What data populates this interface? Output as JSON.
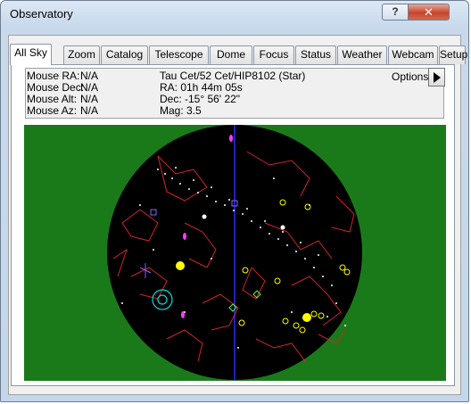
{
  "window": {
    "title": "Observatory",
    "help_label": "?",
    "close_label": "✕"
  },
  "tabs": [
    {
      "label": "All Sky",
      "active": true
    },
    {
      "label": "Zoom"
    },
    {
      "label": "Catalog"
    },
    {
      "label": "Telescope"
    },
    {
      "label": "Dome"
    },
    {
      "label": "Focus"
    },
    {
      "label": "Status"
    },
    {
      "label": "Weather"
    },
    {
      "label": "Webcam"
    },
    {
      "label": "Setup"
    }
  ],
  "mouse": {
    "ra_label": "Mouse RA:",
    "ra_value": "N/A",
    "dec_label": "Mouse Dec:",
    "dec_value": "N/A",
    "alt_label": "Mouse Alt:",
    "alt_value": "N/A",
    "az_label": "Mouse Az:",
    "az_value": "N/A"
  },
  "selected_object": {
    "name": "Tau Cet/52 Cet/HIP8102 (Star)",
    "ra": "RA: 01h 44m 05s",
    "dec": "Dec: -15° 56' 22\"",
    "mag": "Mag: 3.5"
  },
  "options": {
    "label": "Options",
    "arrow_icon": "play-right-icon"
  },
  "colors": {
    "sky_bg": "#1a7a1a",
    "sky_disc": "#000000",
    "constellation": "#d2232a",
    "stars": "#ffffff",
    "galaxies": "#ffff00",
    "meridian": "#2a2aff",
    "planet": "#ffff00",
    "cluster": "#ffff00",
    "telescope_marker": "#00dddd"
  }
}
